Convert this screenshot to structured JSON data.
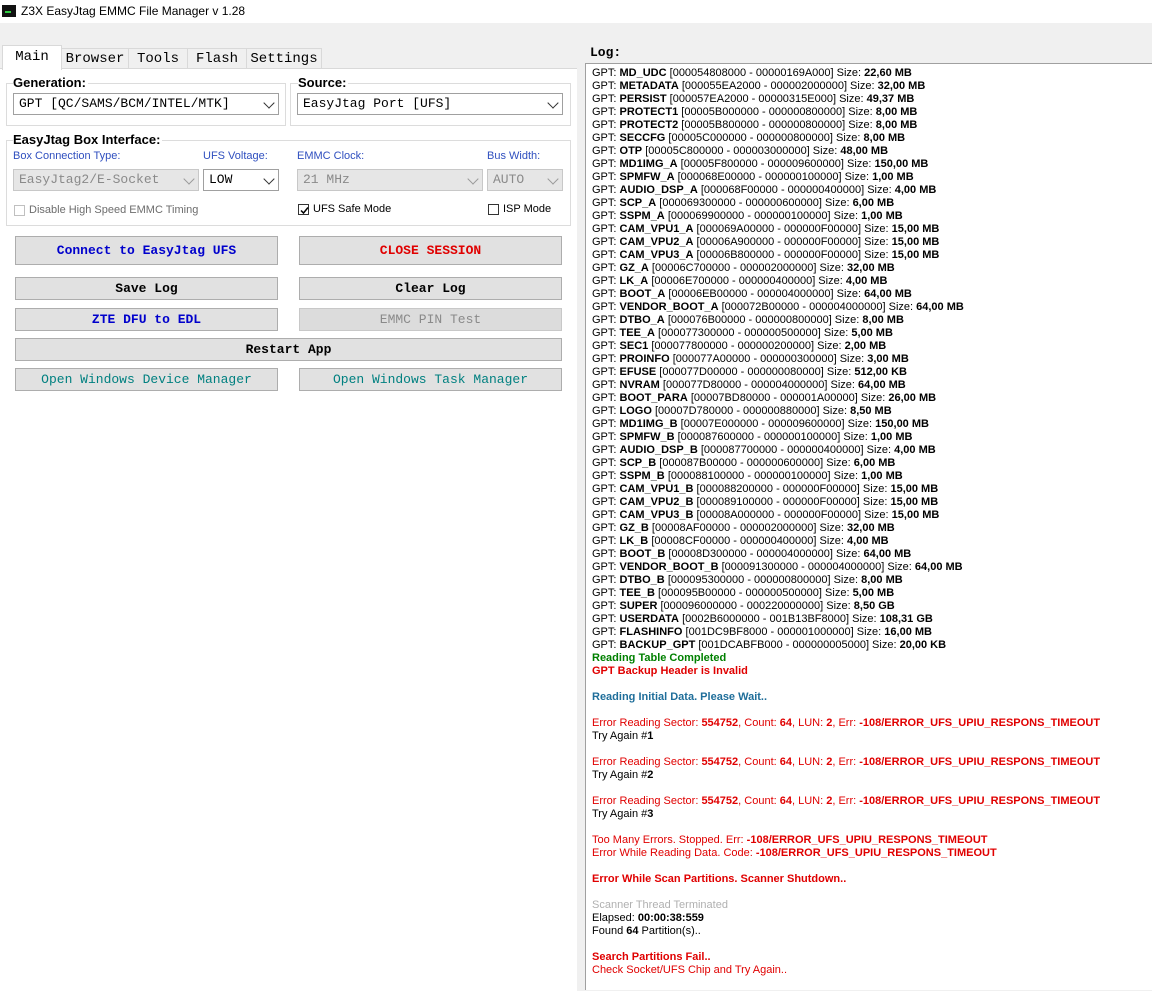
{
  "window": {
    "title": "Z3X EasyJtag EMMC File Manager v 1.28"
  },
  "tabs": [
    "Main",
    "Browser",
    "Tools",
    "Flash",
    "Settings"
  ],
  "generation": {
    "label": "Generation:",
    "value": "GPT [QC/SAMS/BCM/INTEL/MTK]"
  },
  "source": {
    "label": "Source:",
    "value": "EasyJtag Port [UFS]"
  },
  "box_interface": {
    "label": "EasyJtag Box Interface:",
    "connection_type": {
      "label": "Box Connection Type:",
      "value": "EasyJtag2/E-Socket"
    },
    "ufs_voltage": {
      "label": "UFS Voltage:",
      "value": "LOW"
    },
    "emmc_clock": {
      "label": "EMMC Clock:",
      "value": "21 MHz"
    },
    "bus_width": {
      "label": "Bus Width:",
      "value": "AUTO"
    },
    "disable_hs": {
      "label": "Disable High Speed EMMC Timing",
      "checked": false
    },
    "ufs_safe": {
      "label": "UFS Safe Mode",
      "checked": true
    },
    "isp_mode": {
      "label": "ISP Mode",
      "checked": false
    }
  },
  "buttons": {
    "connect": "Connect to EasyJtag UFS",
    "close_session": "CLOSE SESSION",
    "save_log": "Save Log",
    "clear_log": "Clear Log",
    "zte_dfu": "ZTE DFU to EDL",
    "emmc_pin": "EMMC PIN Test",
    "restart": "Restart App",
    "device_manager": "Open Windows Device Manager",
    "task_manager": "Open Windows Task Manager"
  },
  "colors": {
    "blue_btn": "#0000cc",
    "red_btn": "#e00000",
    "teal_btn": "#008080",
    "gray_btn": "#8a8a8a"
  },
  "log_label": "Log:",
  "partitions": [
    [
      "MD_UDC",
      "[000054808000 - 00000169A000]",
      "22,60 MB"
    ],
    [
      "METADATA",
      "[000055EA2000 - 000002000000]",
      "32,00 MB"
    ],
    [
      "PERSIST",
      "[000057EA2000 - 00000315E000]",
      "49,37 MB"
    ],
    [
      "PROTECT1",
      "[00005B000000 - 000000800000]",
      "8,00 MB"
    ],
    [
      "PROTECT2",
      "[00005B800000 - 000000800000]",
      "8,00 MB"
    ],
    [
      "SECCFG",
      "[00005C000000 - 000000800000]",
      "8,00 MB"
    ],
    [
      "OTP",
      "[00005C800000 - 000003000000]",
      "48,00 MB"
    ],
    [
      "MD1IMG_A",
      "[00005F800000 - 000009600000]",
      "150,00 MB"
    ],
    [
      "SPMFW_A",
      "[000068E00000 - 000000100000]",
      "1,00 MB"
    ],
    [
      "AUDIO_DSP_A",
      "[000068F00000 - 000000400000]",
      "4,00 MB"
    ],
    [
      "SCP_A",
      "[000069300000 - 000000600000]",
      "6,00 MB"
    ],
    [
      "SSPM_A",
      "[000069900000 - 000000100000]",
      "1,00 MB"
    ],
    [
      "CAM_VPU1_A",
      "[000069A00000 - 000000F00000]",
      "15,00 MB"
    ],
    [
      "CAM_VPU2_A",
      "[00006A900000 - 000000F00000]",
      "15,00 MB"
    ],
    [
      "CAM_VPU3_A",
      "[00006B800000 - 000000F00000]",
      "15,00 MB"
    ],
    [
      "GZ_A",
      "[00006C700000 - 000002000000]",
      "32,00 MB"
    ],
    [
      "LK_A",
      "[00006E700000 - 000000400000]",
      "4,00 MB"
    ],
    [
      "BOOT_A",
      "[00006EB00000 - 000004000000]",
      "64,00 MB"
    ],
    [
      "VENDOR_BOOT_A",
      "[000072B00000 - 000004000000]",
      "64,00 MB"
    ],
    [
      "DTBO_A",
      "[000076B00000 - 000000800000]",
      "8,00 MB"
    ],
    [
      "TEE_A",
      "[000077300000 - 000000500000]",
      "5,00 MB"
    ],
    [
      "SEC1",
      "[000077800000 - 000000200000]",
      "2,00 MB"
    ],
    [
      "PROINFO",
      "[000077A00000 - 000000300000]",
      "3,00 MB"
    ],
    [
      "EFUSE",
      "[000077D00000 - 000000080000]",
      "512,00 KB"
    ],
    [
      "NVRAM",
      "[000077D80000 - 000004000000]",
      "64,00 MB"
    ],
    [
      "BOOT_PARA",
      "[00007BD80000 - 000001A00000]",
      "26,00 MB"
    ],
    [
      "LOGO",
      "[00007D780000 - 000000880000]",
      "8,50 MB"
    ],
    [
      "MD1IMG_B",
      "[00007E000000 - 000009600000]",
      "150,00 MB"
    ],
    [
      "SPMFW_B",
      "[000087600000 - 000000100000]",
      "1,00 MB"
    ],
    [
      "AUDIO_DSP_B",
      "[000087700000 - 000000400000]",
      "4,00 MB"
    ],
    [
      "SCP_B",
      "[000087B00000 - 000000600000]",
      "6,00 MB"
    ],
    [
      "SSPM_B",
      "[000088100000 - 000000100000]",
      "1,00 MB"
    ],
    [
      "CAM_VPU1_B",
      "[000088200000 - 000000F00000]",
      "15,00 MB"
    ],
    [
      "CAM_VPU2_B",
      "[000089100000 - 000000F00000]",
      "15,00 MB"
    ],
    [
      "CAM_VPU3_B",
      "[00008A000000 - 000000F00000]",
      "15,00 MB"
    ],
    [
      "GZ_B",
      "[00008AF00000 - 000002000000]",
      "32,00 MB"
    ],
    [
      "LK_B",
      "[00008CF00000 - 000000400000]",
      "4,00 MB"
    ],
    [
      "BOOT_B",
      "[00008D300000 - 000004000000]",
      "64,00 MB"
    ],
    [
      "VENDOR_BOOT_B",
      "[000091300000 - 000004000000]",
      "64,00 MB"
    ],
    [
      "DTBO_B",
      "[000095300000 - 000000800000]",
      "8,00 MB"
    ],
    [
      "TEE_B",
      "[000095B00000 - 000000500000]",
      "5,00 MB"
    ],
    [
      "SUPER",
      "[000096000000 - 000220000000]",
      "8,50 GB"
    ],
    [
      "USERDATA",
      "[0002B6000000 - 001B13BF8000]",
      "108,31 GB"
    ],
    [
      "FLASHINFO",
      "[001DC9BF8000 - 000001000000]",
      "16,00 MB"
    ],
    [
      "BACKUP_GPT",
      "[001DCABFB000 - 000000005000]",
      "20,00 KB"
    ]
  ],
  "log_tail": {
    "table_completed": "Reading Table Completed",
    "backup_invalid": "GPT Backup Header is Invalid",
    "initial_data": "Reading Initial Data. Please Wait..",
    "error_sector": "554752",
    "error_count": "64",
    "error_lun": "2",
    "error_err": "-108/ERROR_UFS_UPIU_RESPONS_TIMEOUT",
    "attempts": [
      "1",
      "2",
      "3"
    ],
    "too_many": "Too Many Errors. Stopped. Err: ",
    "error_reading_data": "Error While Reading Data. Code: ",
    "scan_error": "Error While Scan Partitions. Scanner Shutdown..",
    "thread_terminated": "Scanner Thread Terminated",
    "elapsed": "00:00:38:559",
    "found_count": "64",
    "search_fail": "Search Partitions Fail..",
    "check_socket": "Check Socket/UFS Chip and Try Again.."
  }
}
